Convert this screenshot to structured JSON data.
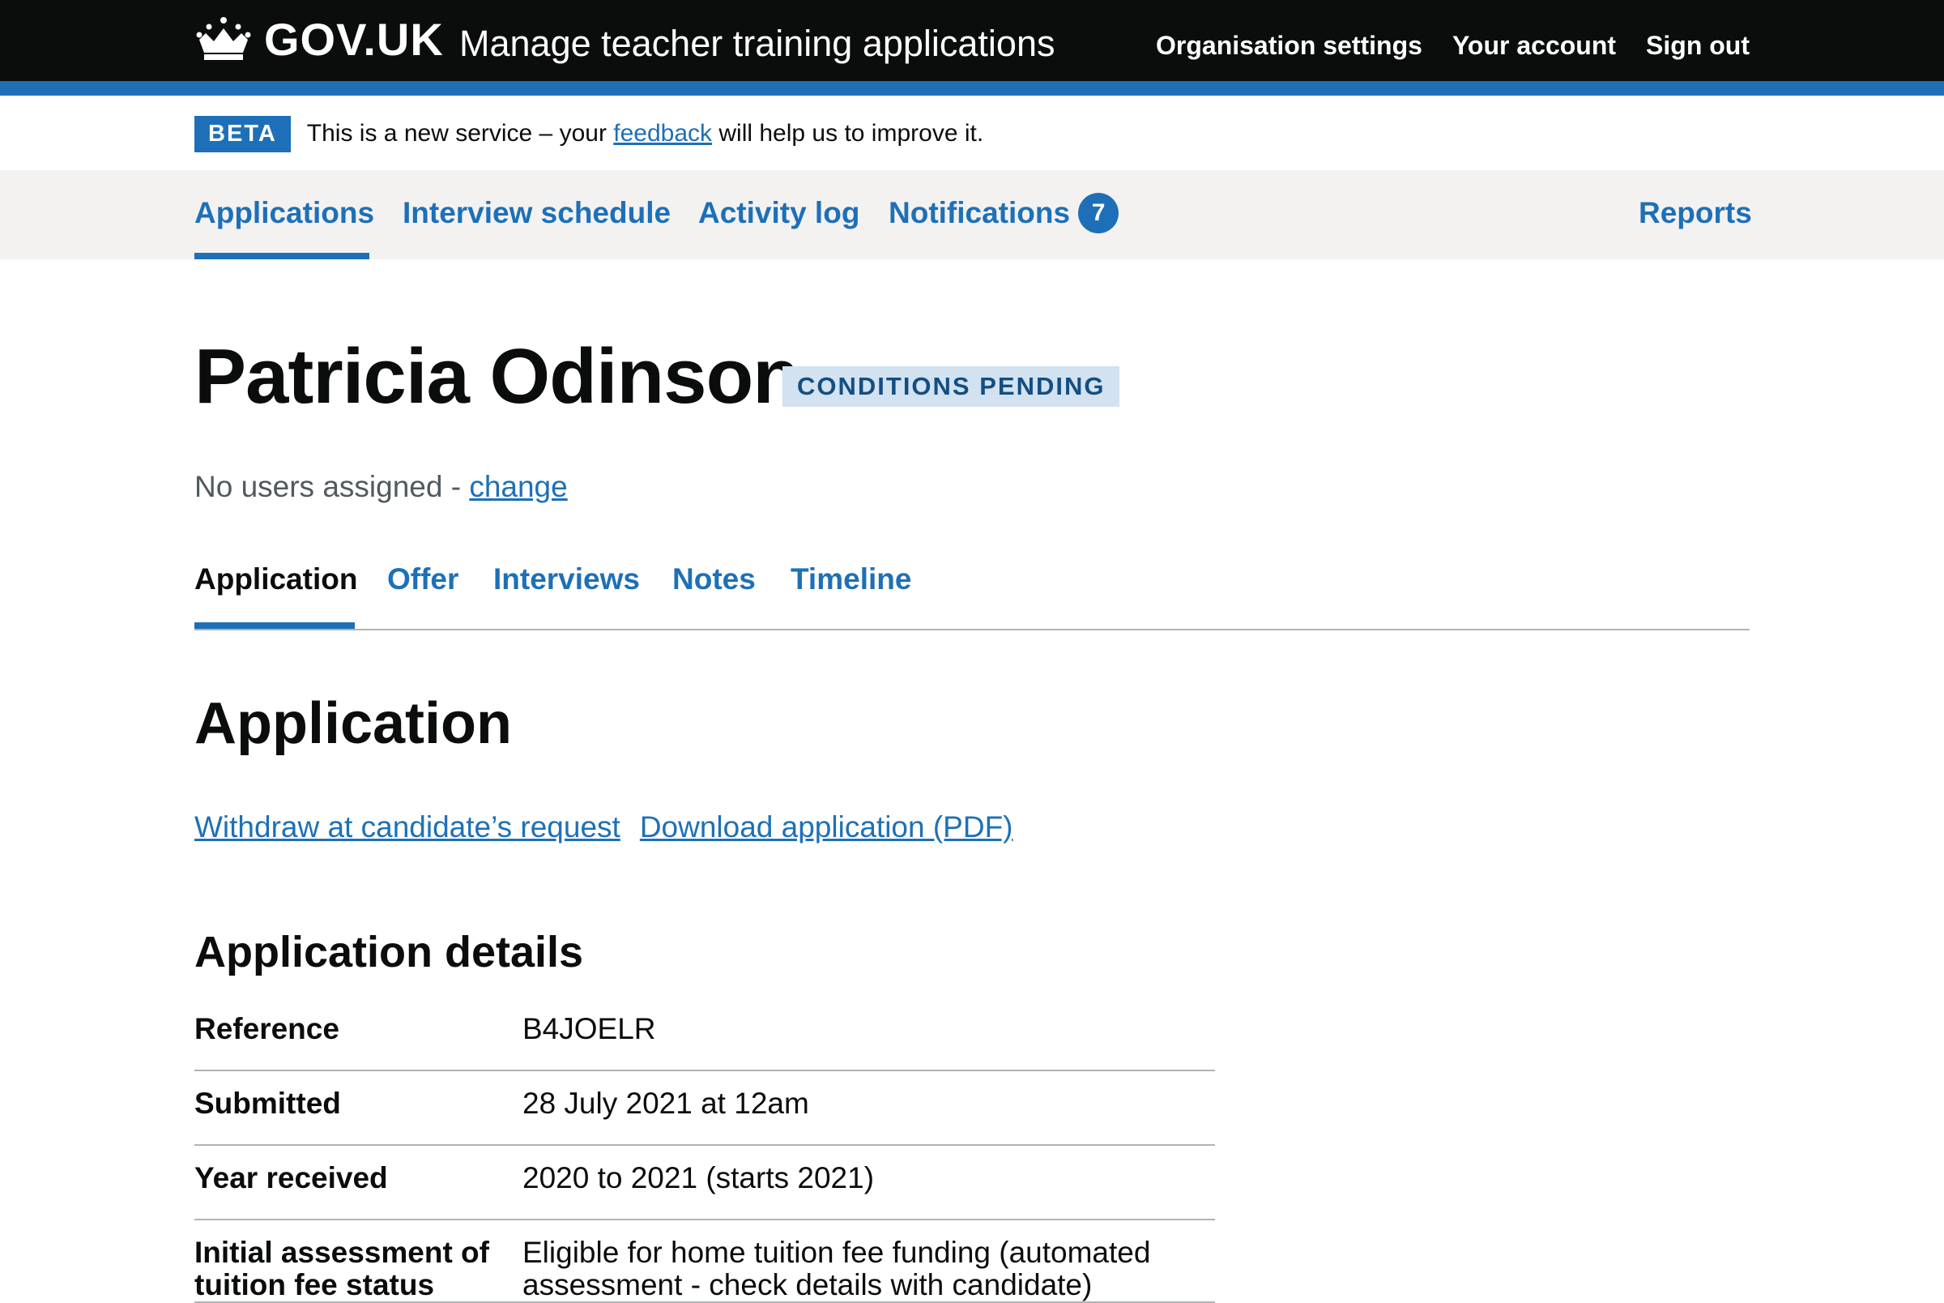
{
  "header": {
    "logo_text": "GOV.UK",
    "service_name": "Manage teacher training applications",
    "nav": [
      "Organisation settings",
      "Your account",
      "Sign out"
    ]
  },
  "beta_banner": {
    "tag": "BETA",
    "text_before": "This is a new service – your ",
    "link": "feedback",
    "text_after": " will help us to improve it."
  },
  "primary_nav": {
    "items": [
      "Applications",
      "Interview schedule",
      "Activity log",
      "Notifications"
    ],
    "notifications_count": "7",
    "reports": "Reports",
    "active": "Applications"
  },
  "candidate": {
    "name": "Patricia Odinson",
    "status": "CONDITIONS PENDING",
    "assignment_text": "No users assigned - ",
    "assignment_link": "change"
  },
  "tabs": {
    "items": [
      "Application",
      "Offer",
      "Interviews",
      "Notes",
      "Timeline"
    ],
    "active": "Application"
  },
  "section": {
    "heading": "Application",
    "actions": [
      "Withdraw at candidate’s request",
      "Download application (PDF)"
    ]
  },
  "details": {
    "heading": "Application details",
    "rows": [
      {
        "key": "Reference",
        "value": "B4JOELR"
      },
      {
        "key": "Submitted",
        "value": "28 July 2021 at 12am"
      },
      {
        "key": "Year received",
        "value": "2020 to 2021 (starts 2021)"
      },
      {
        "key": "Initial assessment of tuition fee status",
        "value": "Eligible for home tuition fee funding (automated assessment - check details with candidate)"
      }
    ]
  },
  "colors": {
    "header_bg": "#0b0c0c",
    "brand_blue": "#1d70b8",
    "nav_bg": "#f3f2f1",
    "tag_bg": "#d2e2f1",
    "tag_text": "#144e81"
  }
}
